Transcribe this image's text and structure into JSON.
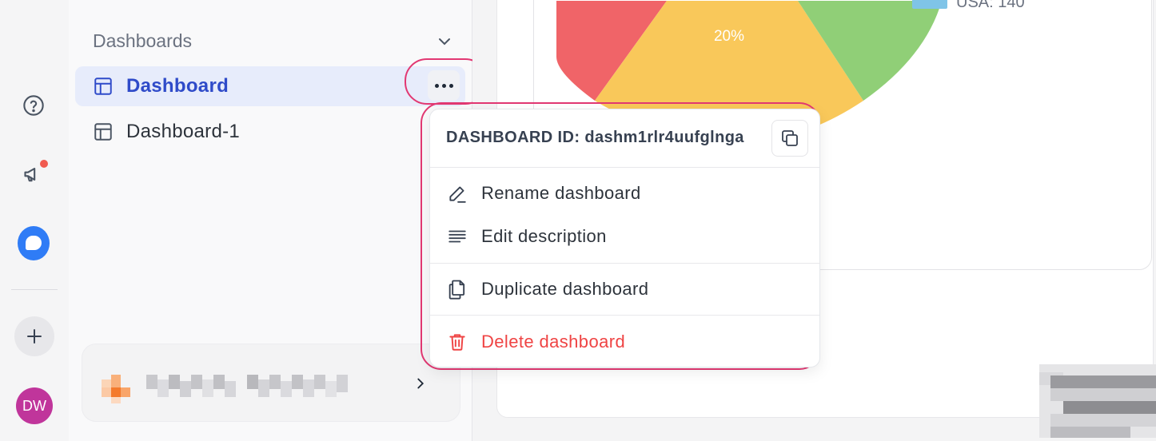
{
  "rail": {
    "avatar_initials": "DW",
    "notification_color": "#f15b50",
    "chat_color": "#2f7cf6",
    "avatar_color": "#c0359b"
  },
  "sidebar": {
    "section_title": "Dashboards",
    "items": [
      {
        "label": "Dashboard",
        "active": true
      },
      {
        "label": "Dashboard-1",
        "active": false
      }
    ],
    "active_color": "#2f4bc9"
  },
  "chart": {
    "slice_label": "20%",
    "legend_partial": "USA: 140",
    "slice_colors": [
      "#f06468",
      "#f9c85a",
      "#90cf77"
    ],
    "legend_color": "#7fc4e8"
  },
  "menu": {
    "dashboard_id": "DASHBOARD ID: dashm1rlr4uufglnga",
    "rename": "Rename dashboard",
    "edit_description": "Edit description",
    "duplicate": "Duplicate dashboard",
    "delete": "Delete dashboard",
    "delete_color": "#ef4444",
    "highlight_color": "#e23872"
  }
}
